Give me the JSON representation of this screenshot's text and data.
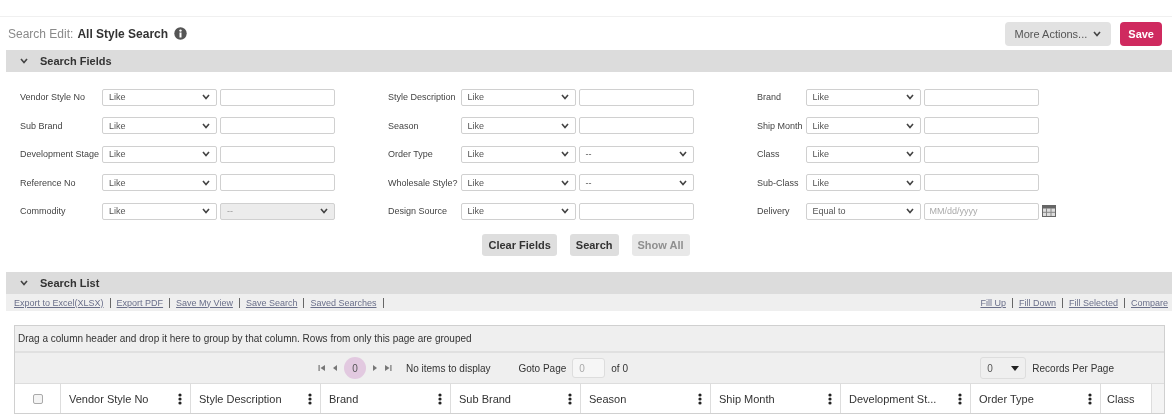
{
  "header": {
    "label": "Search Edit:",
    "title": "All Style Search"
  },
  "actions": [
    {
      "kind": "menu",
      "label": "More Actions..."
    },
    {
      "kind": "primary",
      "label": "Save"
    }
  ],
  "search_fields": {
    "title": "Search Fields",
    "expanded": true,
    "columns": [
      [
        {
          "label": "Vendor Style No",
          "kind": "text",
          "operator": "Like"
        },
        {
          "label": "Sub Brand",
          "kind": "text",
          "operator": "Like"
        },
        {
          "label": "Development Stage",
          "kind": "text",
          "operator": "Like"
        },
        {
          "label": "Reference No",
          "kind": "text",
          "operator": "Like"
        },
        {
          "label": "Commodity",
          "kind": "select",
          "operator": "Like",
          "value": "--",
          "disabled": true
        }
      ],
      [
        {
          "label": "Style Description",
          "kind": "text",
          "operator": "Like"
        },
        {
          "label": "Season",
          "kind": "text",
          "operator": "Like"
        },
        {
          "label": "Order Type",
          "kind": "select",
          "operator": "Like",
          "value": "--",
          "disabled": false
        },
        {
          "label": "Wholesale Style?",
          "kind": "select",
          "operator": "Like",
          "value": "--",
          "disabled": false
        },
        {
          "label": "Design Source",
          "kind": "text",
          "operator": "Like"
        }
      ],
      [
        {
          "label": "Brand",
          "kind": "text",
          "operator": "Like"
        },
        {
          "label": "Ship Month",
          "kind": "text",
          "operator": "Like"
        },
        {
          "label": "Class",
          "kind": "text",
          "operator": "Like"
        },
        {
          "label": "Sub-Class",
          "kind": "text",
          "operator": "Like"
        },
        {
          "label": "Delivery",
          "kind": "date",
          "operator": "Equal to",
          "placeholder": "MM/dd/yyyy"
        }
      ]
    ]
  },
  "form_buttons": [
    {
      "label": "Clear Fields",
      "disabled": false
    },
    {
      "label": "Search",
      "disabled": false
    },
    {
      "label": "Show All",
      "disabled": true
    }
  ],
  "search_list": {
    "title": "Search List",
    "expanded": true,
    "links": [
      "Export to Excel(XLSX)",
      "Export PDF",
      "Save My View",
      "Save Search",
      "Saved Searches"
    ],
    "fill_links": [
      "Fill Up",
      "Fill Down",
      "Fill Selected",
      "Compare"
    ],
    "group_hint": "Drag a column header and drop it here to group by that column. Rows from only this page are grouped",
    "pager": {
      "page": "0",
      "status": "No items to display",
      "goto_label": "Goto Page",
      "goto_value": "0",
      "page_count": "of 0",
      "per_page": "0",
      "per_page_label": "Records Per Page"
    },
    "select_all_checked": false,
    "columns": [
      {
        "label": "Vendor Style No",
        "menu": true
      },
      {
        "label": "Style Description",
        "menu": true
      },
      {
        "label": "Brand",
        "menu": true
      },
      {
        "label": "Sub Brand",
        "menu": true
      },
      {
        "label": "Season",
        "menu": true
      },
      {
        "label": "Ship Month",
        "menu": true
      },
      {
        "label": "Development St...",
        "menu": true
      },
      {
        "label": "Order Type",
        "menu": true
      },
      {
        "label": "Class",
        "menu": false
      }
    ]
  }
}
